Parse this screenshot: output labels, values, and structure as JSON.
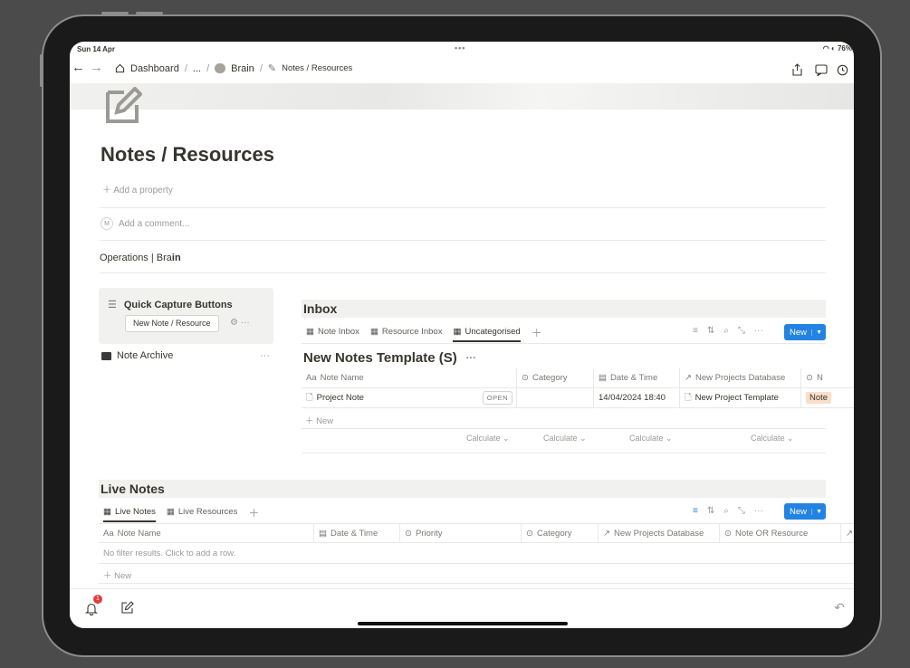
{
  "status": {
    "date": "Sun 14 Apr",
    "battery": "76%"
  },
  "breadcrumb": {
    "dashboard": "Dashboard",
    "ellipsis": "...",
    "brain": "Brain",
    "current": "Notes / Resources"
  },
  "page": {
    "title": "Notes / Resources",
    "add_property": "Add a property",
    "add_comment": "Add a comment...",
    "avatar_initial": "M",
    "operations_link_a": "Operations | Bra",
    "operations_link_b": "in"
  },
  "quick_capture": {
    "title": "Quick Capture Buttons",
    "button_label": "New Note / Resource"
  },
  "archive": {
    "label": "Note Archive"
  },
  "inbox": {
    "header": "Inbox",
    "tabs": [
      "Note Inbox",
      "Resource Inbox",
      "Uncategorised"
    ],
    "new_label": "New",
    "view_title": "New Notes Template (S)",
    "columns": [
      "Note Name",
      "Category",
      "Date & Time",
      "New Projects Database",
      "N"
    ],
    "row": {
      "name": "Project Note",
      "open": "OPEN",
      "date": "14/04/2024 18:40",
      "project": "New Project Template",
      "tag": "Note"
    },
    "add_row": "New",
    "calculate": "Calculate"
  },
  "live": {
    "header": "Live Notes",
    "tabs": [
      "Live Notes",
      "Live Resources"
    ],
    "new_label": "New",
    "columns": [
      "Note Name",
      "Date & Time",
      "Priority",
      "Category",
      "New Projects Database",
      "Note OR Resource"
    ],
    "no_filter": "No filter results. Click to add a row.",
    "add_row": "New"
  },
  "bottom": {
    "badge_count": "1"
  },
  "colors": {
    "accent": "#2383e2",
    "tag": "#fadec9",
    "badge": "#e03e3e"
  }
}
